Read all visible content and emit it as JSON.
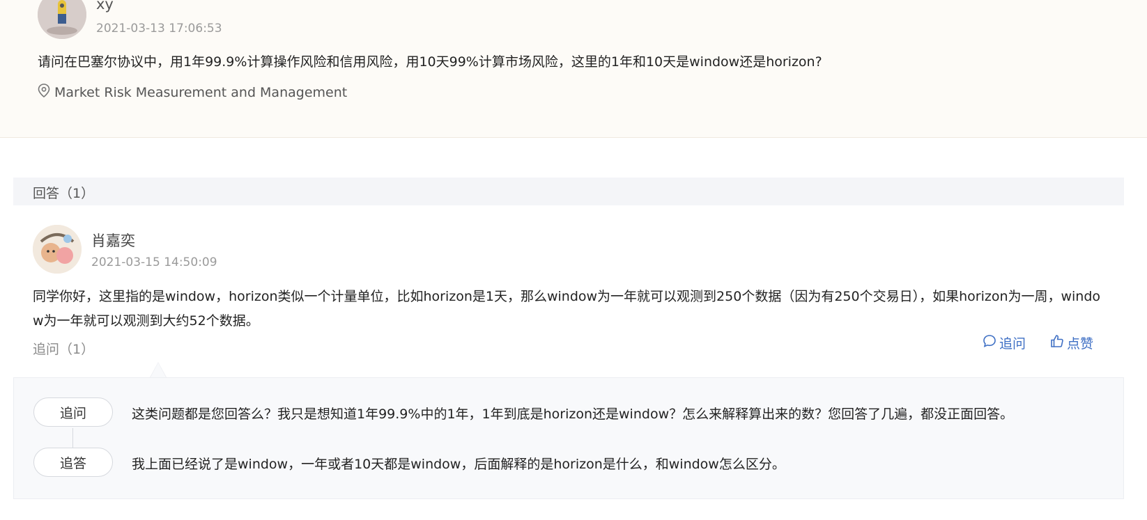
{
  "question": {
    "user": "xy",
    "time": "2021-03-13 17:06:53",
    "text": "请问在巴塞尔协议中，用1年99.9%计算操作风险和信用风险，用10天99%计算市场风险，这里的1年和10天是window还是horizon?",
    "tag": "Market Risk Measurement and Management"
  },
  "answers": {
    "header": "回答（1）"
  },
  "answer": {
    "user": "肖嘉奕",
    "time": "2021-03-15 14:50:09",
    "text": "同学你好，这里指的是window，horizon类似一个计量单位，比如horizon是1天，那么window为一年就可以观测到250个数据（因为有250个交易日），如果horizon为一周，window为一年就可以观测到大约52个数据。",
    "followup_count": "追问（1）",
    "ask_label": "追问",
    "like_label": "点赞"
  },
  "thread": [
    {
      "type": "追问",
      "text": "这类问题都是您回答么？我只是想知道1年99.9%中的1年，1年到底是horizon还是window？怎么来解释算出来的数？您回答了几遍，都没正面回答。"
    },
    {
      "type": "追答",
      "text": "我上面已经说了是window，一年或者10天都是window，后面解释的是horizon是什么，和window怎么区分。"
    }
  ],
  "colors": {
    "link": "#3e6fc4",
    "question_bg": "#fdfbf7",
    "bar_bg": "#f4f5f8"
  },
  "icons": {
    "tag": "location-pin-icon",
    "ask": "chat-bubble-icon",
    "like": "thumbs-up-icon"
  }
}
